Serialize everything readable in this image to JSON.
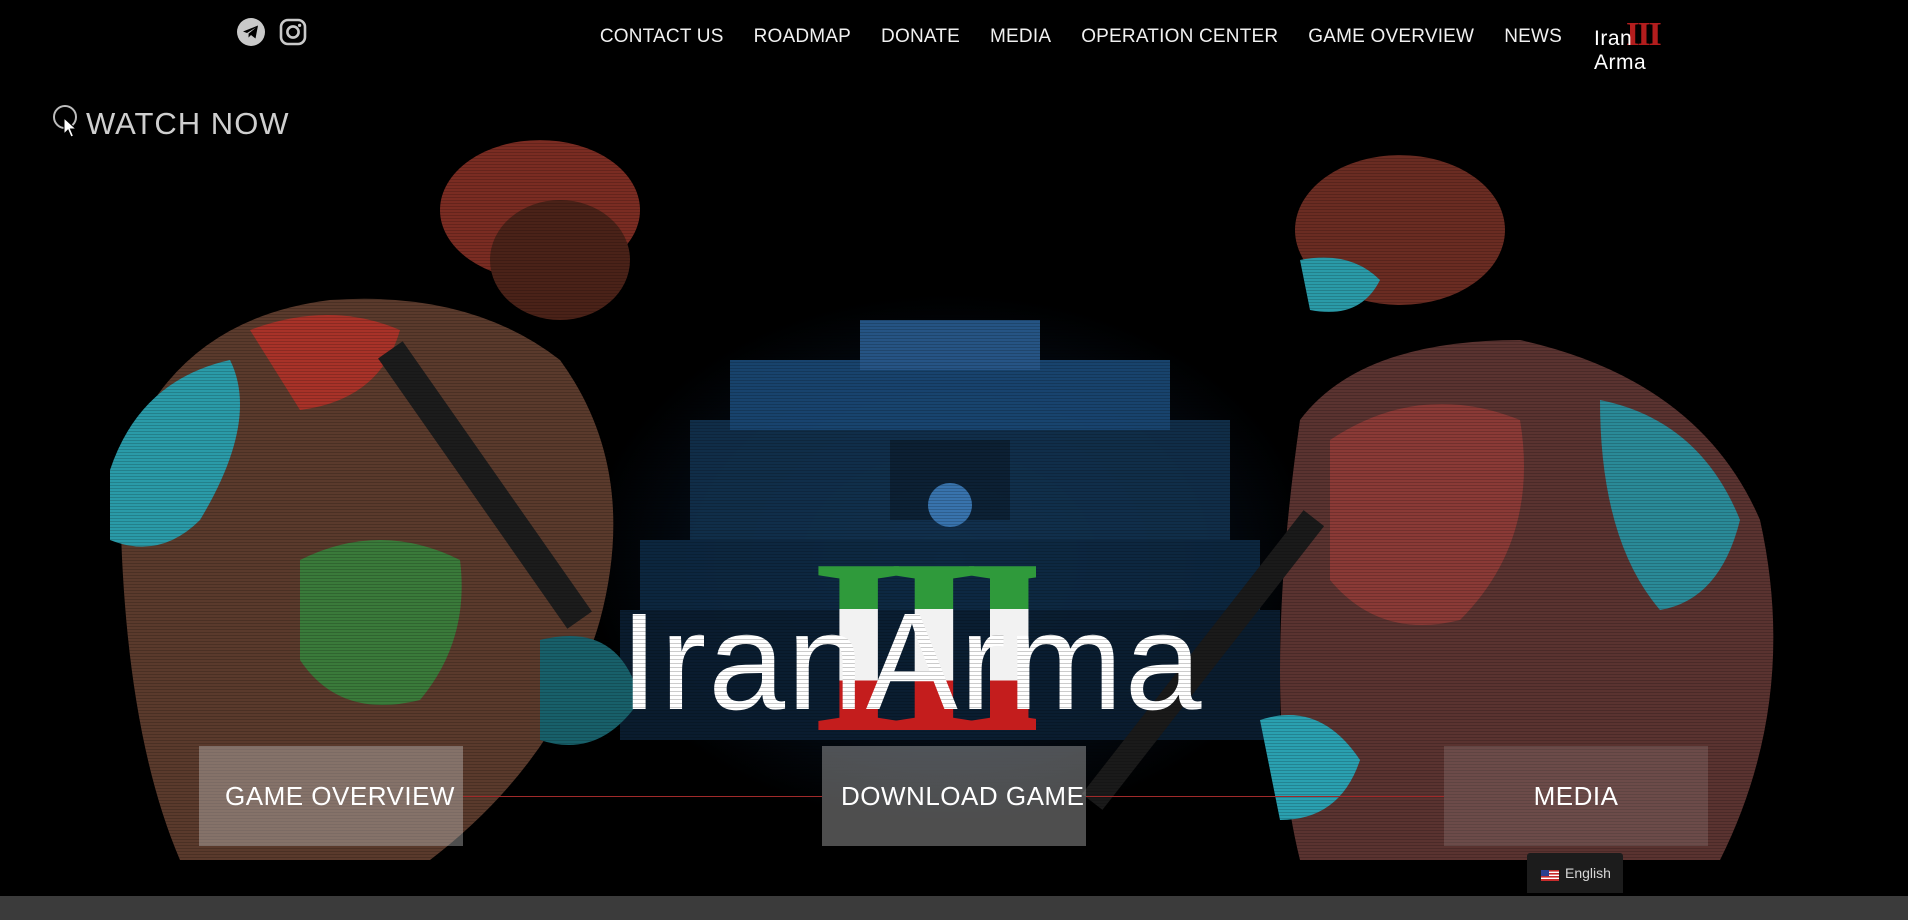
{
  "header": {
    "social": [
      {
        "icon": "telegram-icon"
      },
      {
        "icon": "instagram-icon"
      }
    ],
    "nav": [
      {
        "label": "CONTACT US"
      },
      {
        "label": "ROADMAP"
      },
      {
        "label": "DONATE"
      },
      {
        "label": "MEDIA"
      },
      {
        "label": "OPERATION CENTER"
      },
      {
        "label": "GAME OVERVIEW"
      },
      {
        "label": "NEWS"
      }
    ],
    "logo": {
      "word": "Iran Arma",
      "roman": "III"
    }
  },
  "hero": {
    "watch_now": "WATCH NOW",
    "logo": {
      "word": "IranArma",
      "roman": "III"
    }
  },
  "actions": {
    "game_overview": "GAME OVERVIEW",
    "download_game": "DOWNLOAD GAME",
    "media": "MEDIA"
  },
  "language": {
    "label": "English",
    "flag": "us-flag-icon"
  },
  "colors": {
    "background": "#000000",
    "flag_green": "#2f9a3b",
    "flag_white": "#f2f2f2",
    "flag_red": "#c41d1d",
    "box_bg": "rgba(205,205,205,0.38)",
    "connector": "#a02a2a"
  }
}
